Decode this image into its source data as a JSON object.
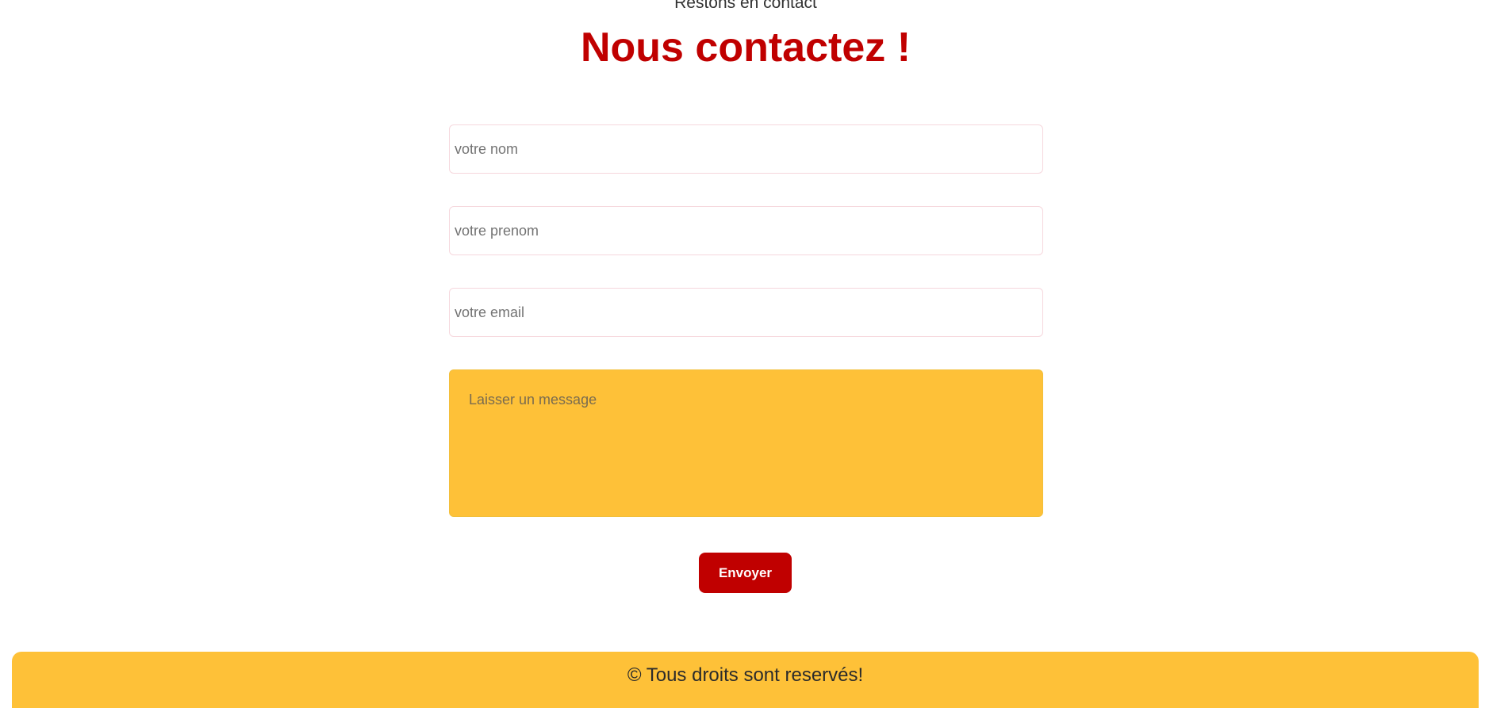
{
  "header": {
    "subtitle": "Restons en contact",
    "title": "Nous contactez !"
  },
  "form": {
    "name_placeholder": "votre nom",
    "firstname_placeholder": "votre prenom",
    "email_placeholder": "votre email",
    "message_placeholder": "Laisser un message",
    "submit_label": "Envoyer"
  },
  "footer": {
    "copyright": "© Tous droits sont reservés!"
  },
  "colors": {
    "accent_red": "#c00000",
    "accent_yellow": "#fec138",
    "input_border": "#f6d7dd"
  }
}
